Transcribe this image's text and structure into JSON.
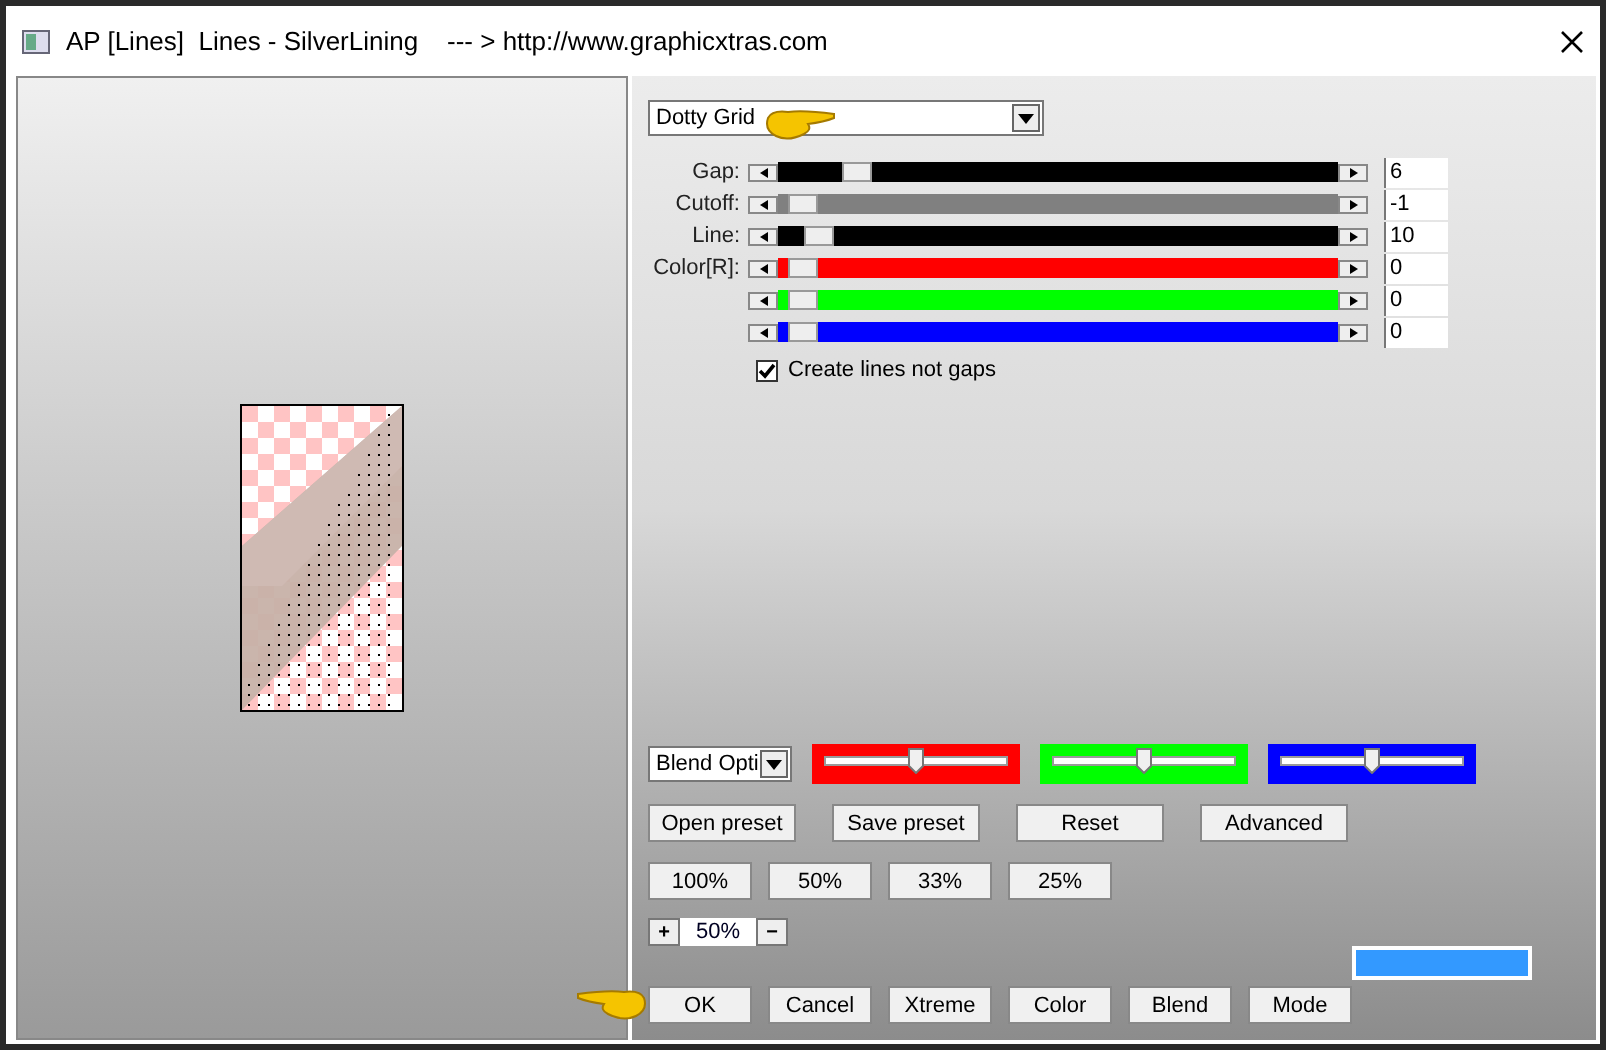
{
  "window": {
    "title": "AP [Lines]  Lines - SilverLining    --- > http://www.graphicxtras.com"
  },
  "mode_select": {
    "value": "Dotty Grid"
  },
  "sliders": [
    {
      "label": "Gap:",
      "color": "#000000",
      "level": 0.12,
      "value": "6"
    },
    {
      "label": "Cutoff:",
      "color": "#808080",
      "level": 0.02,
      "value": "-1"
    },
    {
      "label": "Line:",
      "color": "#000000",
      "level": 0.05,
      "value": "10"
    },
    {
      "label": "Color[R]:",
      "color": "#ff0000",
      "level": 0.02,
      "value": "0"
    },
    {
      "color": "#00ff00",
      "level": 0.02,
      "value": "0"
    },
    {
      "color": "#0000ff",
      "level": 0.02,
      "value": "0"
    }
  ],
  "create_lines_checkbox": {
    "label": "Create lines not gaps",
    "checked": true
  },
  "blend_select": {
    "value": "Blend Opti"
  },
  "blend_sliders": [
    {
      "color": "#ff0000",
      "level": 0.5
    },
    {
      "color": "#00ff00",
      "level": 0.5
    },
    {
      "color": "#0000ff",
      "level": 0.5
    }
  ],
  "preset_buttons": [
    "Open preset",
    "Save preset",
    "Reset",
    "Advanced"
  ],
  "zoom_buttons": [
    "100%",
    "50%",
    "33%",
    "25%"
  ],
  "zoom_stepper": {
    "plus": "+",
    "value": "50%",
    "minus": "−"
  },
  "color_swatch": {
    "color": "#3399ff"
  },
  "action_buttons": [
    "OK",
    "Cancel",
    "Xtreme",
    "Color",
    "Blend",
    "Mode"
  ]
}
